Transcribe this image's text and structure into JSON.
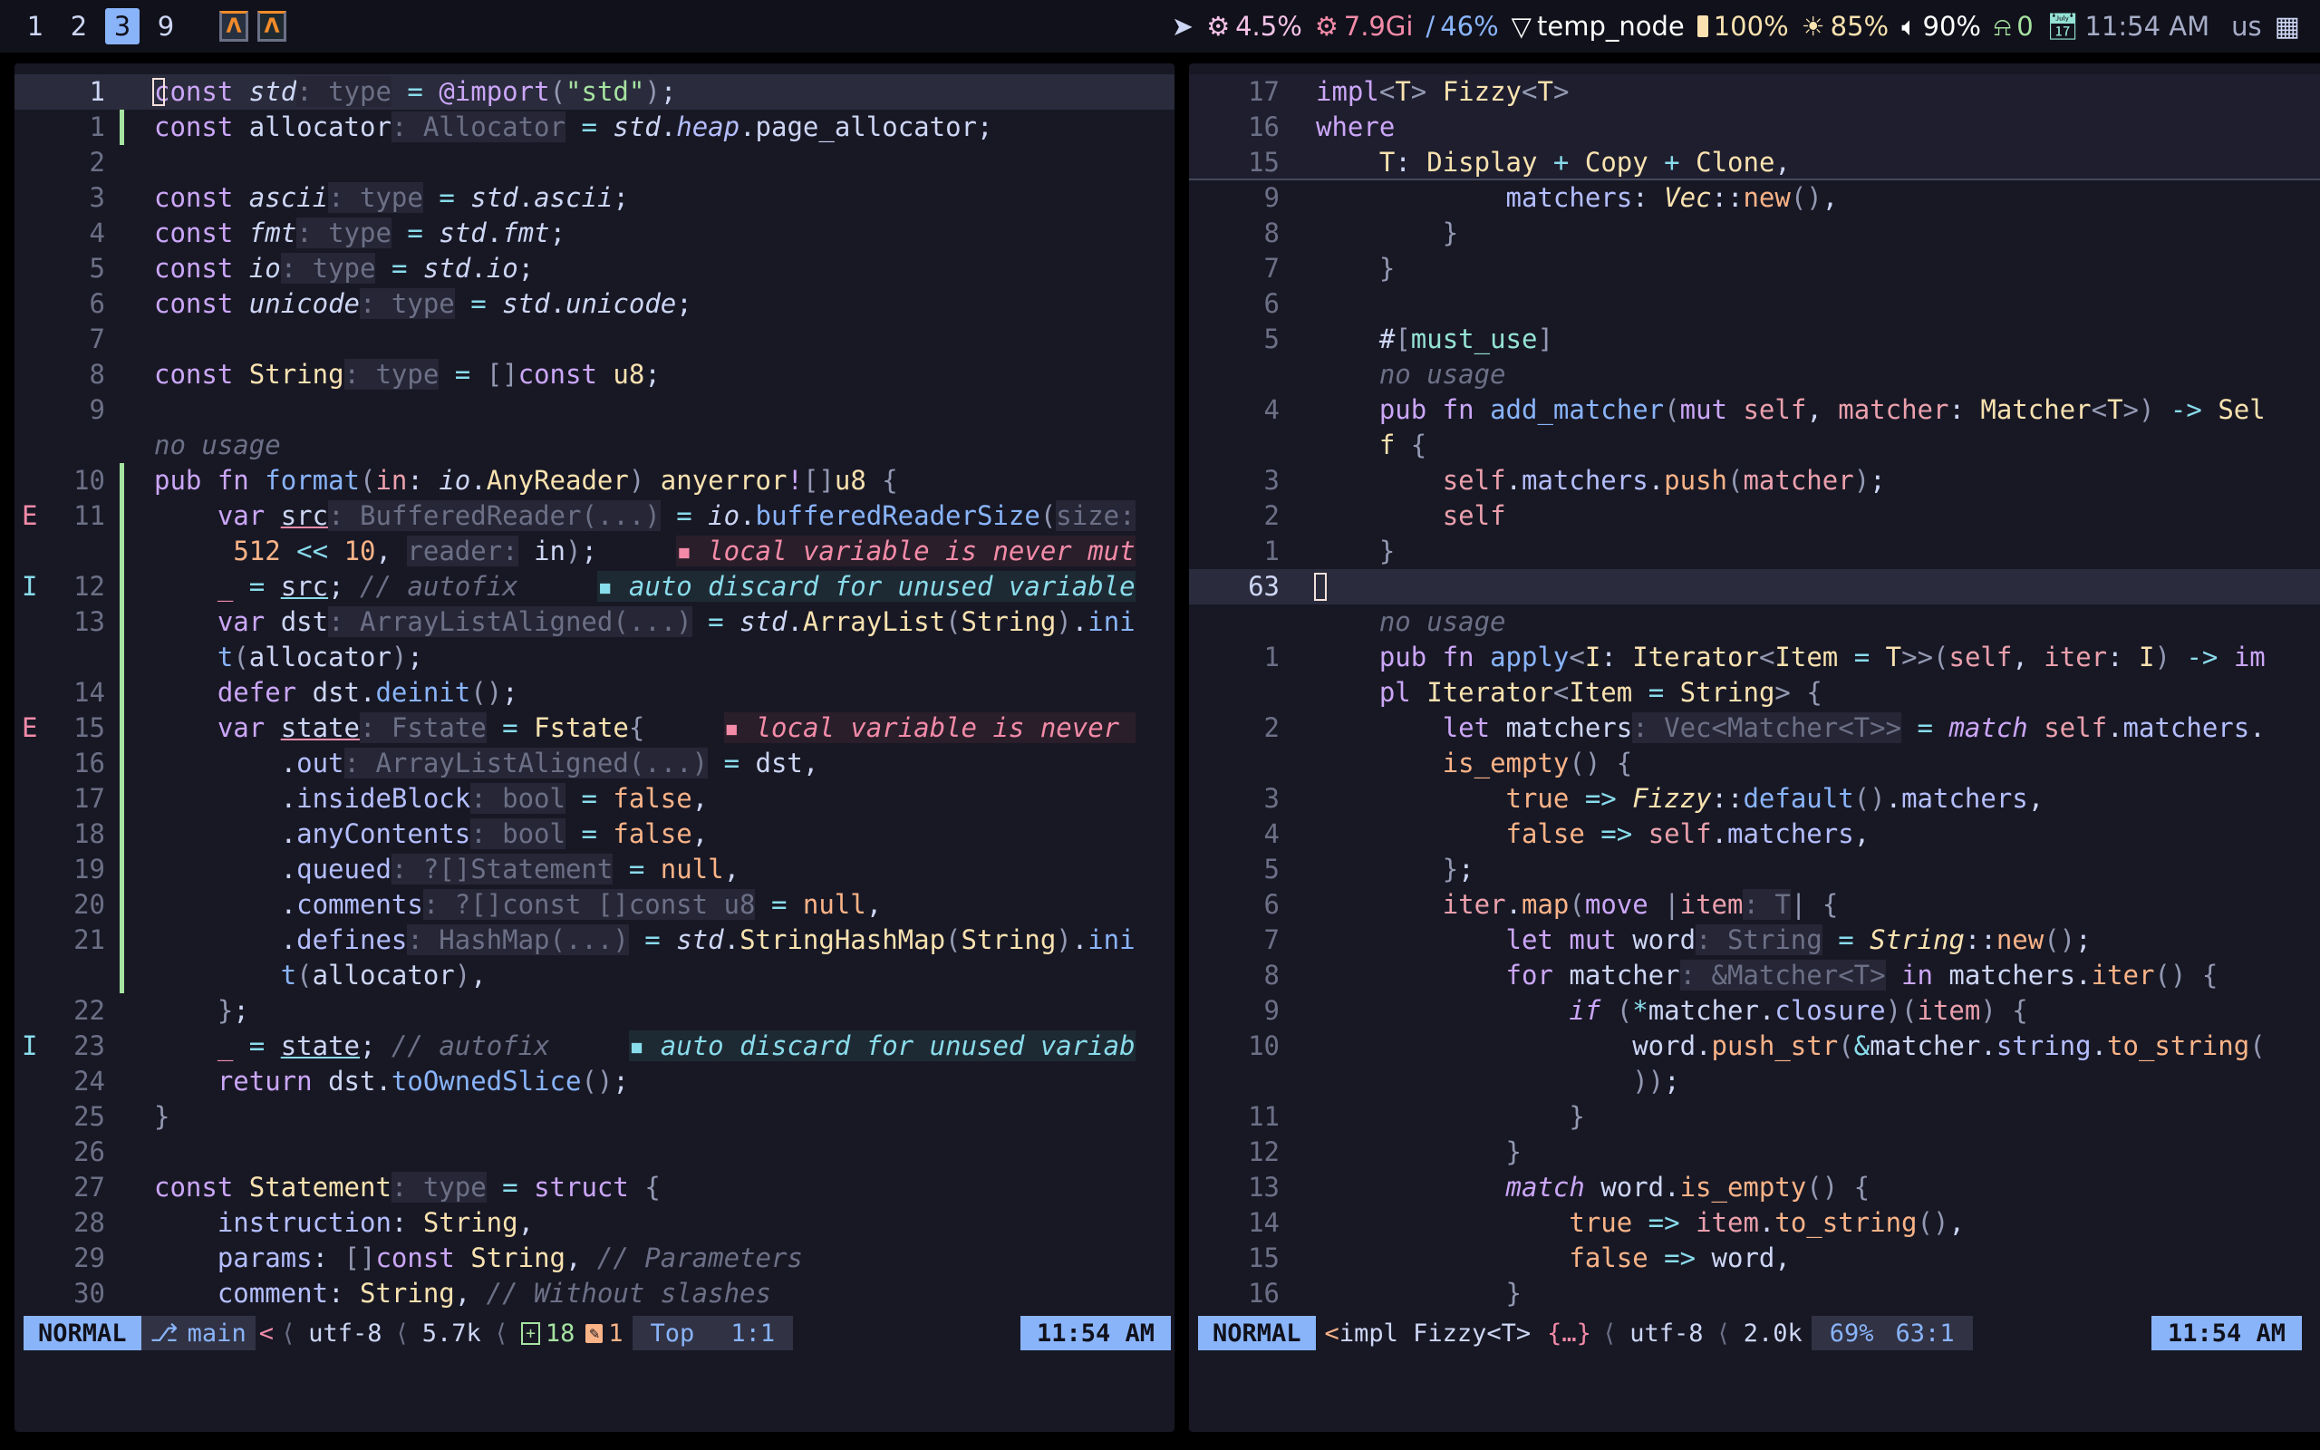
{
  "topbar": {
    "workspaces": [
      {
        "label": "1",
        "active": false
      },
      {
        "label": "2",
        "active": false
      },
      {
        "label": "3",
        "active": true
      },
      {
        "label": "9",
        "active": false
      }
    ],
    "apps": [
      "alacritty-icon",
      "alacritty-icon"
    ],
    "status": {
      "cpu": "4.5%",
      "memory": "7.9Gi",
      "disk": "46%",
      "network": "temp_node",
      "battery": "100%",
      "brightness": "85%",
      "volume": "90%",
      "notifications": "0",
      "time": "11:54 AM",
      "keyboard_layout": "us"
    },
    "colors": {
      "active_ws": "#89b4fa",
      "cpu": "#f5c2e7",
      "memory": "#f38ba8",
      "disk": "#89b4fa",
      "battery": "#f9e2af",
      "notifications": "#a6e3a1",
      "clock": "#94e2d5"
    }
  },
  "left_editor": {
    "lines": [
      {
        "num": "1",
        "sign": "",
        "html": "<span class='kw'>const</span> <span class='va it'>std</span><span class='hint'>: type</span> <span class='op'>=</span> <span class='kw'>@import</span><span class='br'>(</span><span class='st'>\"std\"</span><span class='br'>)</span>;",
        "cursor": true
      },
      {
        "num": "1",
        "sign": "",
        "html": "<span class='kw'>const</span> allocator<span class='hint'>: Allocator</span> <span class='op'>=</span> <span class='va it'>std</span>.<span class='it pr'>heap</span>.page_allocator;"
      },
      {
        "num": "2",
        "sign": "",
        "html": ""
      },
      {
        "num": "3",
        "sign": "",
        "html": "<span class='kw'>const</span> <span class='it'>ascii</span><span class='hint'>: type</span> <span class='op'>=</span> <span class='it'>std</span>.<span class='it'>ascii</span>;"
      },
      {
        "num": "4",
        "sign": "",
        "html": "<span class='kw'>const</span> <span class='it'>fmt</span><span class='hint'>: type</span> <span class='op'>=</span> <span class='it'>std</span>.<span class='it'>fmt</span>;"
      },
      {
        "num": "5",
        "sign": "",
        "html": "<span class='kw'>const</span> <span class='it'>io</span><span class='hint'>: type</span> <span class='op'>=</span> <span class='it'>std</span>.<span class='it'>io</span>;"
      },
      {
        "num": "6",
        "sign": "",
        "html": "<span class='kw'>const</span> <span class='it'>unicode</span><span class='hint'>: type</span> <span class='op'>=</span> <span class='it'>std</span>.<span class='it'>unicode</span>;"
      },
      {
        "num": "7",
        "sign": "",
        "html": ""
      },
      {
        "num": "8",
        "sign": "",
        "html": "<span class='kw'>const</span> <span class='ty'>String</span><span class='hint'>: type</span> <span class='op'>=</span> <span class='br'>[]</span><span class='kw'>const</span> <span class='ty'>u8</span>;"
      },
      {
        "num": "9",
        "sign": "",
        "html": ""
      },
      {
        "num": "",
        "sign": "",
        "html": "<span class='cm'>no usage</span>"
      },
      {
        "num": "10",
        "sign": "",
        "html": "<span class='kw'>pub fn</span> <span class='fn'>format</span><span class='br'>(</span><span class='pa'>in</span>: <span class='it'>io</span>.<span class='ty'>AnyReader</span><span class='br'>)</span> <span class='ty'>anyerror</span><span class='kw'>!</span><span class='br'>[]</span><span class='ty'>u8</span> <span class='br'>{</span>"
      },
      {
        "num": "11",
        "sign": "E",
        "html": "    <span class='kw'>var</span> <span class='ul-err'>src</span><span class='hint'>: BufferedReader(...)</span> <span class='op'>=</span> <span class='it'>io</span>.<span class='fn'>bufferedReaderSize</span><span class='br'>(</span><span class='hint'>size:</span>"
      },
      {
        "num": "",
        "sign": "",
        "html": "     <span class='nu'>512</span> <span class='op'>&lt;&lt;</span> <span class='nu'>10</span>, <span class='hint'>reader:</span> in<span class='br'>)</span>;     <span class='diag-err'>▪ local variable is never mut</span>"
      },
      {
        "num": "12",
        "sign": "I",
        "html": "    <span class='err'>_</span> <span class='op'>=</span> <span class='ul-info'>src</span>; <span class='cm'>// autofix</span>     <span class='diag-info'>▪ auto discard for unused variable</span>"
      },
      {
        "num": "13",
        "sign": "",
        "html": "    <span class='kw'>var</span> dst<span class='hint'>: ArrayListAligned(...)</span> <span class='op'>=</span> <span class='it'>std</span>.<span class='ty'>ArrayList</span><span class='br'>(</span><span class='ty'>String</span><span class='br'>)</span>.<span class='fn'>ini</span>"
      },
      {
        "num": "",
        "sign": "",
        "html": "    <span class='fn'>t</span><span class='br'>(</span>allocator<span class='br'>)</span>;"
      },
      {
        "num": "14",
        "sign": "",
        "html": "    <span class='kw'>defer</span> dst.<span class='fn'>deinit</span><span class='br'>()</span>;"
      },
      {
        "num": "15",
        "sign": "E",
        "html": "    <span class='kw'>var</span> <span class='ul-err'>state</span><span class='hint'>: Fstate</span> <span class='op'>=</span> <span class='ty'>Fstate</span><span class='br'>{</span>     <span class='diag-err'>▪ local variable is never </span>"
      },
      {
        "num": "16",
        "sign": "",
        "html": "        .<span class='pr'>out</span><span class='hint'>: ArrayListAligned(...)</span> <span class='op'>=</span> dst,"
      },
      {
        "num": "17",
        "sign": "",
        "html": "        .<span class='pr'>insideBlock</span><span class='hint'>: bool</span> <span class='op'>=</span> <span class='nu'>false</span>,"
      },
      {
        "num": "18",
        "sign": "",
        "html": "        .<span class='pr'>anyContents</span><span class='hint'>: bool</span> <span class='op'>=</span> <span class='nu'>false</span>,"
      },
      {
        "num": "19",
        "sign": "",
        "html": "        .<span class='pr'>queued</span><span class='hint'>: ?[]Statement</span> <span class='op'>=</span> <span class='nu'>null</span>,"
      },
      {
        "num": "20",
        "sign": "",
        "html": "        .<span class='pr'>comments</span><span class='hint'>: ?[]const []const u8</span> <span class='op'>=</span> <span class='nu'>null</span>,"
      },
      {
        "num": "21",
        "sign": "",
        "html": "        .<span class='pr'>defines</span><span class='hint'>: HashMap(...)</span> <span class='op'>=</span> <span class='it'>std</span>.<span class='ty'>StringHashMap</span><span class='br'>(</span><span class='ty'>String</span><span class='br'>)</span>.<span class='fn'>ini</span>"
      },
      {
        "num": "",
        "sign": "",
        "html": "        <span class='fn'>t</span><span class='br'>(</span>allocator<span class='br'>)</span>,"
      },
      {
        "num": "22",
        "sign": "",
        "html": "    <span class='br'>}</span>;"
      },
      {
        "num": "23",
        "sign": "I",
        "html": "    <span class='err'>_</span> <span class='op'>=</span> <span class='ul-info'>state</span>; <span class='cm'>// autofix</span>     <span class='diag-info'>▪ auto discard for unused variab</span>"
      },
      {
        "num": "24",
        "sign": "",
        "html": "    <span class='kw'>return</span> dst.<span class='fn'>toOwnedSlice</span><span class='br'>()</span>;"
      },
      {
        "num": "25",
        "sign": "",
        "html": "<span class='br'>}</span>"
      },
      {
        "num": "26",
        "sign": "",
        "html": ""
      },
      {
        "num": "27",
        "sign": "",
        "html": "<span class='kw'>const</span> <span class='ty'>Statement</span><span class='hint'>: type</span> <span class='op'>=</span> <span class='kw'>struct</span> <span class='br'>{</span>"
      },
      {
        "num": "28",
        "sign": "",
        "html": "    <span class='pr'>instruction</span>: <span class='ty'>String</span>,"
      },
      {
        "num": "29",
        "sign": "",
        "html": "    <span class='pr'>params</span>: <span class='br'>[]</span><span class='kw'>const</span> <span class='ty'>String</span>, <span class='cm'>// Parameters</span>"
      },
      {
        "num": "30",
        "sign": "",
        "html": "    <span class='pr'>comment</span>: <span class='ty'>String</span>, <span class='cm'>// Without slashes</span>"
      }
    ],
    "status": {
      "mode": "NORMAL",
      "branch": "main",
      "encoding": "utf-8",
      "size": "5.7k",
      "added": "18",
      "modified": "1",
      "position_label": "Top",
      "cursor": "1:1",
      "time": "11:54 AM"
    }
  },
  "right_editor": {
    "lines": [
      {
        "num": "17",
        "html": "<span class='kw'>impl</span><span class='br'>&lt;</span><span class='ty'>T</span><span class='br'>&gt;</span> <span class='ty'>Fizzy</span><span class='br'>&lt;</span><span class='ty'>T</span><span class='br'>&gt;</span>",
        "sticky": true
      },
      {
        "num": "16",
        "html": "<span class='kw'>where</span>",
        "sticky": true
      },
      {
        "num": "15",
        "html": "    <span class='ty'>T</span>: <span class='ty'>Display</span> <span class='op'>+</span> <span class='ty'>Copy</span> <span class='op'>+</span> <span class='ty'>Clone</span>,",
        "sticky": true
      },
      {
        "num": "9",
        "html": "            <span class='pr'>matchers</span>: <span class='ty it'>Vec</span>::<span class='nu'>new</span><span class='br'>()</span>,"
      },
      {
        "num": "8",
        "html": "        <span class='br'>}</span>"
      },
      {
        "num": "7",
        "html": "    <span class='br'>}</span>"
      },
      {
        "num": "6",
        "html": ""
      },
      {
        "num": "5",
        "html": "    #<span class='br'>[</span><span class='st' style='color:#94e2d5'>must_use</span><span class='br'>]</span>"
      },
      {
        "num": "",
        "html": "    <span class='cm'>no usage</span>"
      },
      {
        "num": "4",
        "html": "    <span class='kw'>pub fn</span> <span class='fn'>add_matcher</span><span class='br'>(</span><span class='kw'>mut</span> <span class='pa'>self</span>, <span class='pa'>matcher</span>: <span class='ty'>Matcher</span><span class='br'>&lt;</span><span class='ty'>T</span><span class='br'>&gt;)</span> <span class='op'>-&gt;</span> <span class='ty'>Sel</span>"
      },
      {
        "num": "",
        "html": "    <span class='ty'>f</span> <span class='br'>{</span>"
      },
      {
        "num": "3",
        "html": "        <span class='pa'>self</span>.<span class='pr'>matchers</span>.<span class='nu'>push</span><span class='br'>(</span><span class='pa'>matcher</span><span class='br'>)</span>;"
      },
      {
        "num": "2",
        "html": "        <span class='pa'>self</span>"
      },
      {
        "num": "1",
        "html": "    <span class='br'>}</span>"
      },
      {
        "num": "63",
        "html": "",
        "cursor": true
      },
      {
        "num": "",
        "html": "    <span class='cm'>no usage</span>"
      },
      {
        "num": "1",
        "html": "    <span class='kw'>pub fn</span> <span class='fn'>apply</span><span class='br'>&lt;</span><span class='ty'>I</span>: <span class='ty'>Iterator</span><span class='br'>&lt;</span><span class='ty'>Item</span> <span class='op'>=</span> <span class='ty'>T</span><span class='br'>&gt;&gt;(</span><span class='pa'>self</span>, <span class='pa'>iter</span>: <span class='ty'>I</span><span class='br'>)</span> <span class='op'>-&gt;</span> <span class='kw'>im</span>"
      },
      {
        "num": "",
        "html": "    <span class='kw'>pl</span> <span class='ty'>Iterator</span><span class='br'>&lt;</span><span class='ty'>Item</span> <span class='op'>=</span> <span class='ty'>String</span><span class='br'>&gt;</span> <span class='br'>{</span>"
      },
      {
        "num": "2",
        "html": "        <span class='kw'>let</span> matchers<span class='hint'>: Vec&lt;Matcher&lt;T&gt;&gt;</span> <span class='op'>=</span> <span class='kw it'>match</span> <span class='pa'>self</span>.<span class='pr'>matchers</span>."
      },
      {
        "num": "",
        "html": "        <span class='nu'>is_empty</span><span class='br'>()</span> <span class='br'>{</span>"
      },
      {
        "num": "3",
        "html": "            <span class='nu'>true</span> <span class='op'>=&gt;</span> <span class='ty it'>Fizzy</span>::<span class='fn'>default</span><span class='br'>()</span>.<span class='pr'>matchers</span>,"
      },
      {
        "num": "4",
        "html": "            <span class='nu'>false</span> <span class='op'>=&gt;</span> <span class='pa'>self</span>.<span class='pr'>matchers</span>,"
      },
      {
        "num": "5",
        "html": "        <span class='br'>}</span>;"
      },
      {
        "num": "6",
        "html": "        <span class='pa'>iter</span>.<span class='nu'>map</span><span class='br'>(</span><span class='kw'>move</span> <span class='br'>|</span><span class='pa'>item</span><span class='hint'>: T</span><span class='br'>|</span> <span class='br'>{</span>"
      },
      {
        "num": "7",
        "html": "            <span class='kw'>let mut</span> word<span class='hint'>: String</span> <span class='op'>=</span> <span class='ty it'>String</span>::<span class='nu'>new</span><span class='br'>()</span>;"
      },
      {
        "num": "8",
        "html": "            <span class='kw'>for</span> matcher<span class='hint'>: &amp;Matcher&lt;T&gt;</span> <span class='kw'>in</span> matchers.<span class='nu'>iter</span><span class='br'>()</span> <span class='br'>{</span>"
      },
      {
        "num": "9",
        "html": "                <span class='kw it'>if</span> <span class='br'>(</span><span class='op'>*</span>matcher.<span class='pr'>closure</span><span class='br'>)(</span><span class='pa'>item</span><span class='br'>)</span> <span class='br'>{</span>"
      },
      {
        "num": "10",
        "html": "                    word.<span class='nu'>push_str</span><span class='br'>(</span><span class='op'>&amp;</span>matcher.<span class='pr'>string</span>.<span class='nu'>to_string</span><span class='br'>(</span>"
      },
      {
        "num": "",
        "html": "                    <span class='br'>))</span>;"
      },
      {
        "num": "11",
        "html": "                <span class='br'>}</span>"
      },
      {
        "num": "12",
        "html": "            <span class='br'>}</span>"
      },
      {
        "num": "13",
        "html": "            <span class='kw it'>match</span> word.<span class='nu'>is_empty</span><span class='br'>()</span> <span class='br'>{</span>"
      },
      {
        "num": "14",
        "html": "                <span class='nu'>true</span> <span class='op'>=&gt;</span> <span class='pa'>item</span>.<span class='nu'>to_string</span><span class='br'>()</span>,"
      },
      {
        "num": "15",
        "html": "                <span class='nu'>false</span> <span class='op'>=&gt;</span> word,"
      },
      {
        "num": "16",
        "html": "            <span class='br'>}</span>"
      }
    ],
    "status": {
      "mode": "NORMAL",
      "context": "impl Fizzy<T>",
      "encoding": "utf-8",
      "size": "2.0k",
      "percent": "69%",
      "cursor": "63:1",
      "time": "11:54 AM"
    }
  }
}
